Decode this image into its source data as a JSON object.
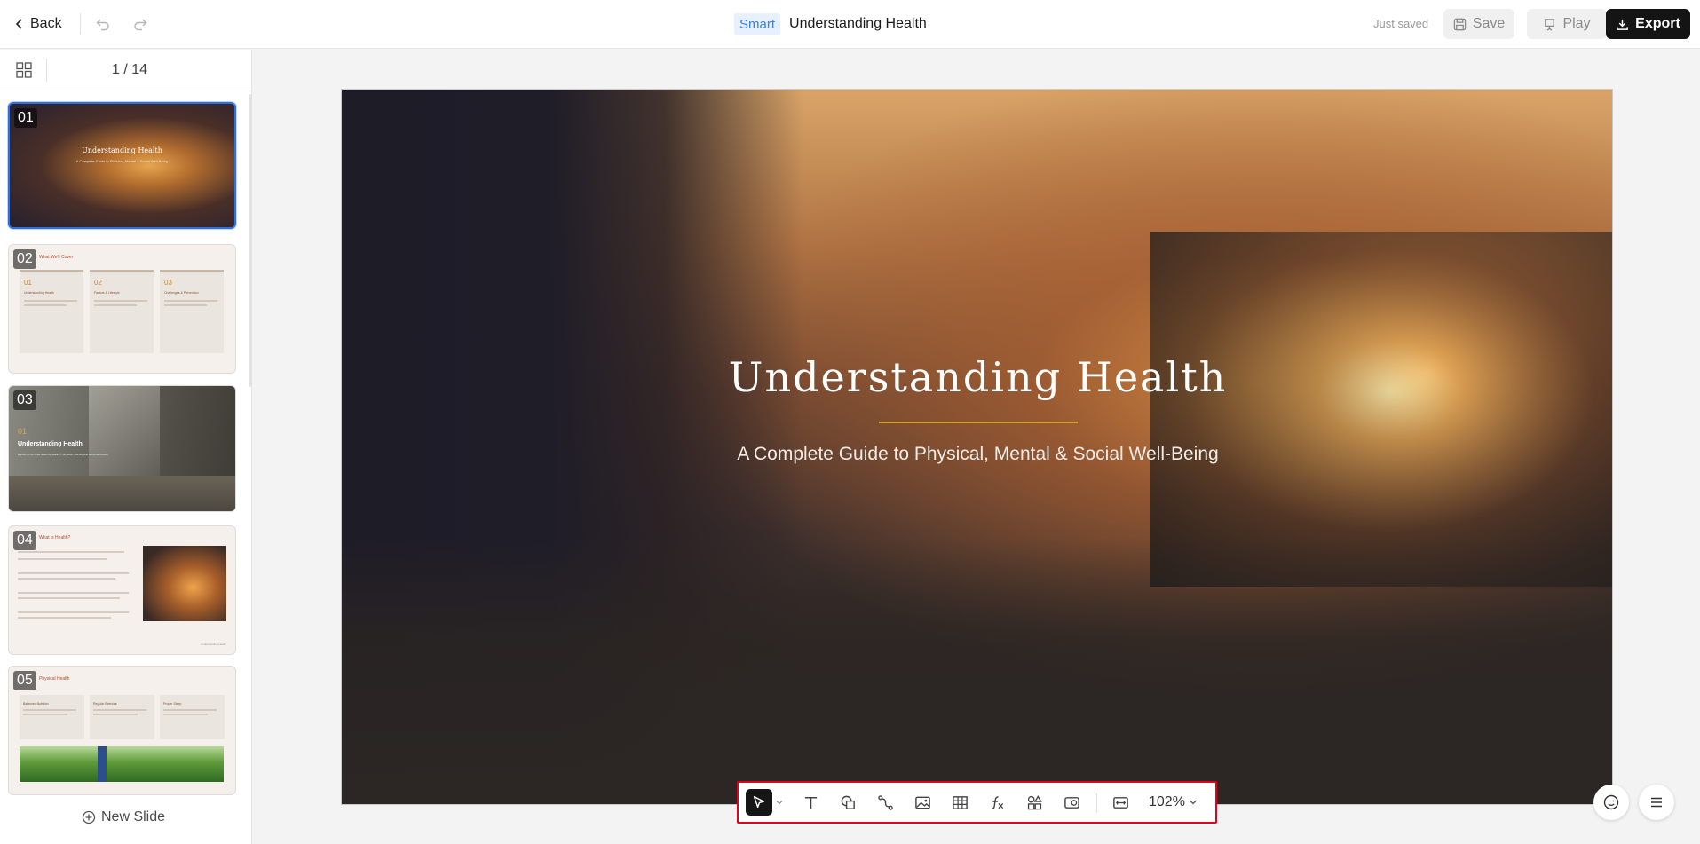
{
  "header": {
    "back_label": "Back",
    "badge": "Smart",
    "title": "Understanding Health",
    "status": "Just saved",
    "save_label": "Save",
    "play_label": "Play",
    "export_label": "Export"
  },
  "sidebar": {
    "page_counter": "1 / 14",
    "new_slide_label": "New Slide",
    "thumbnails": [
      {
        "num": "01",
        "title": "Understanding Health",
        "subtitle": "A Complete Guide to Physical, Mental & Social Well-Being"
      },
      {
        "num": "02",
        "heading": "What We'll Cover",
        "cols": [
          {
            "n": "01",
            "t": "Understanding Health"
          },
          {
            "n": "02",
            "t": "Factors & Lifestyle"
          },
          {
            "n": "03",
            "t": "Challenges & Prevention"
          }
        ]
      },
      {
        "num": "03",
        "index": "01",
        "title": "Understanding Health",
        "subtitle": "Exploring the three pillars of health — physical, mental, and social well-being"
      },
      {
        "num": "04",
        "heading": "What is Health?",
        "footer": "Understanding Health"
      },
      {
        "num": "05",
        "heading": "Physical Health",
        "boxes": [
          "Balanced Nutrition",
          "Regular Exercise",
          "Proper Sleep"
        ]
      }
    ]
  },
  "slide": {
    "title": "Understanding Health",
    "subtitle": "A Complete Guide to Physical, Mental & Social Well-Being"
  },
  "toolbar": {
    "zoom": "102%",
    "tools": [
      "select-icon",
      "text-icon",
      "shape-icon",
      "connector-icon",
      "image-icon",
      "table-icon",
      "formula-icon",
      "components-icon",
      "media-icon",
      "fit-width-icon"
    ]
  },
  "colors": {
    "accent_blue": "#2f6fe0",
    "toolbar_highlight": "#e3001b",
    "title_rule": "#d3a12d",
    "export_bg": "#141414"
  }
}
